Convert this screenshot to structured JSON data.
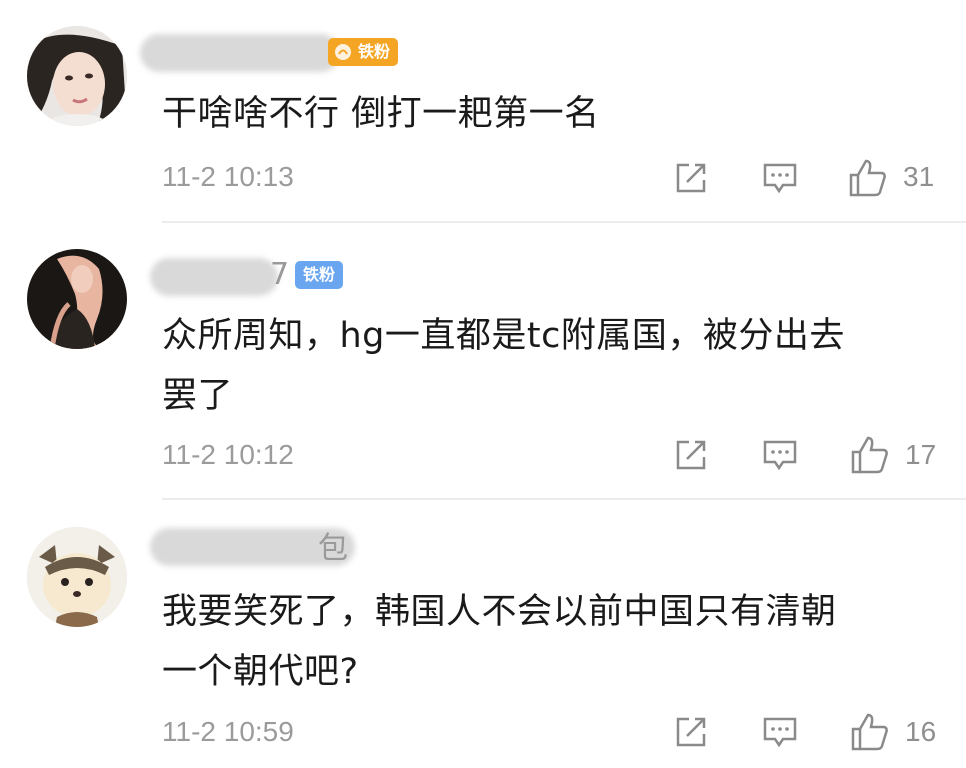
{
  "comments": [
    {
      "badge": "铁粉",
      "text": "干啥啥不行 倒打一耙第一名",
      "time": "11-2 10:13",
      "likes": "31",
      "avatar_icon": "girl-portrait-avatar"
    },
    {
      "name_tail": "7",
      "badge": "铁粉",
      "text_line1": "众所周知，hg一直都是tc附属国，被分出去",
      "text_line2": "罢了",
      "time": "11-2 10:12",
      "likes": "17",
      "avatar_icon": "blonde-woman-avatar"
    },
    {
      "name_visible": "包",
      "text_line1": "我要笑死了，韩国人不会以前中国只有清朝",
      "text_line2": "一个朝代吧?",
      "time": "11-2 10:59",
      "likes": "16",
      "avatar_icon": "hamster-avatar"
    }
  ],
  "icons": {
    "share": "share-icon",
    "reply": "comment-icon",
    "like": "thumbs-up-icon"
  },
  "colors": {
    "badge_orange": "#f5a524",
    "badge_blue": "#6aa6ef",
    "meta_gray": "#9b9b9b"
  }
}
